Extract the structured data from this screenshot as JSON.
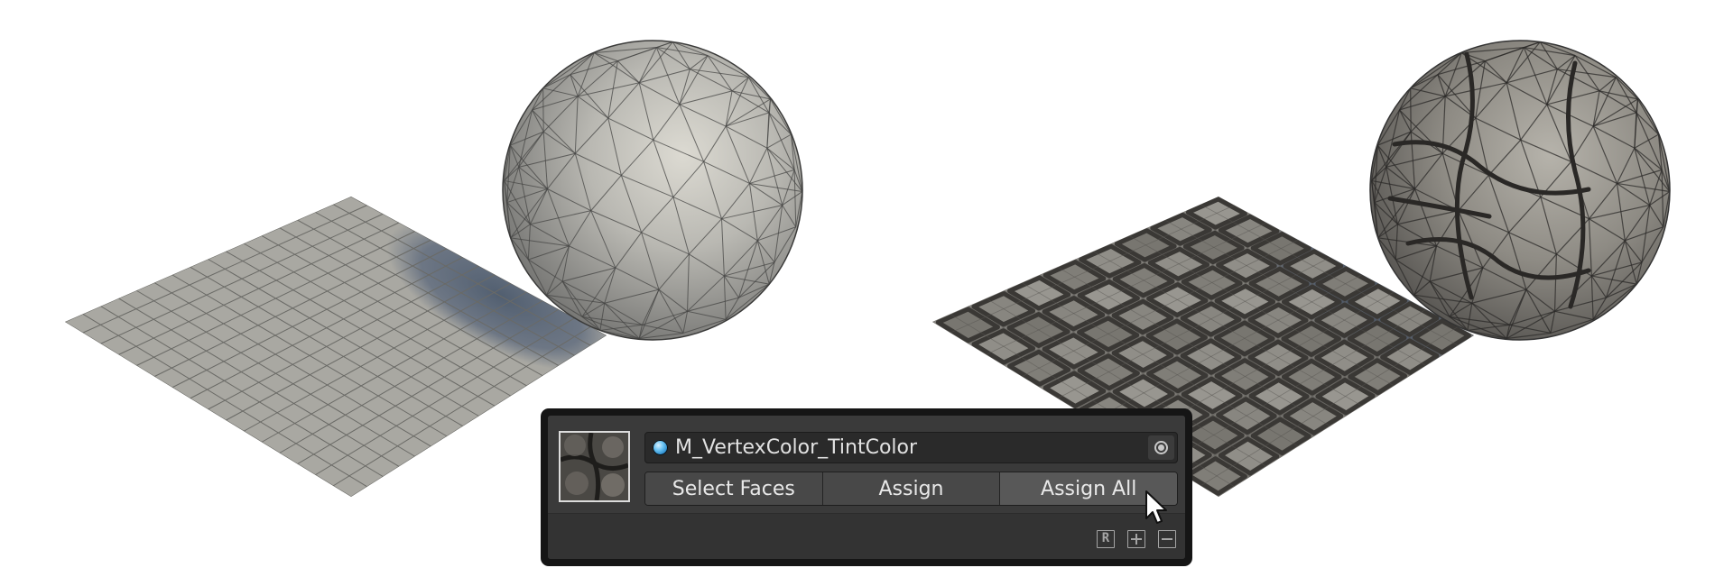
{
  "material_panel": {
    "material_name": "M_VertexColor_TintColor",
    "buttons": {
      "select_faces": "Select Faces",
      "assign": "Assign",
      "assign_all": "Assign All"
    },
    "footer_icons": [
      "reset-icon",
      "add-icon",
      "remove-icon"
    ],
    "footer_reset_glyph": "R"
  },
  "colors": {
    "panel_frame": "#151515",
    "panel_body": "#3a3a3a",
    "material_dot": "#6cc4f4",
    "shadow": "#3c4e6c",
    "stone": "#8a8780"
  }
}
